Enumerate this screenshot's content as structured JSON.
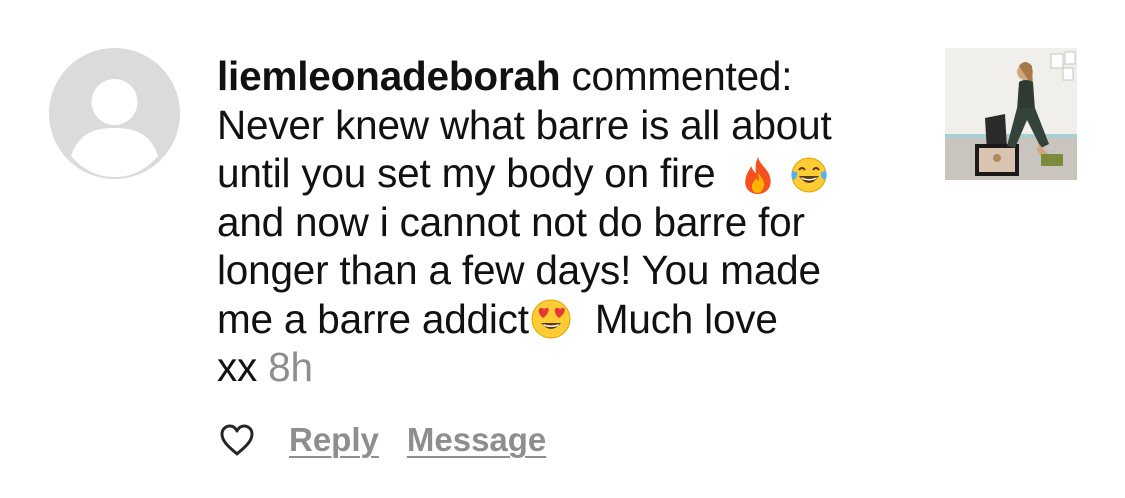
{
  "comment": {
    "username": "liemleonadeborah",
    "action_text": "commented:",
    "line1": "Never knew what barre is all about",
    "line2": "until you set my body on fire",
    "line3": "and now i cannot not do barre for",
    "line4": "longer than a few days! You made",
    "line5_a": "me a barre addict",
    "line5_b": "Much love",
    "line6": "xx",
    "time": "8h"
  },
  "emojis": {
    "fire": "fire-emoji",
    "laugh": "face-with-tears-of-joy-emoji",
    "heart_eyes": "smiling-face-with-heart-eyes-emoji"
  },
  "actions": {
    "reply_label": "Reply",
    "message_label": "Message"
  },
  "colors": {
    "text": "#111111",
    "secondary": "#8e8e8e",
    "avatar_bg": "#dbdbdb"
  }
}
